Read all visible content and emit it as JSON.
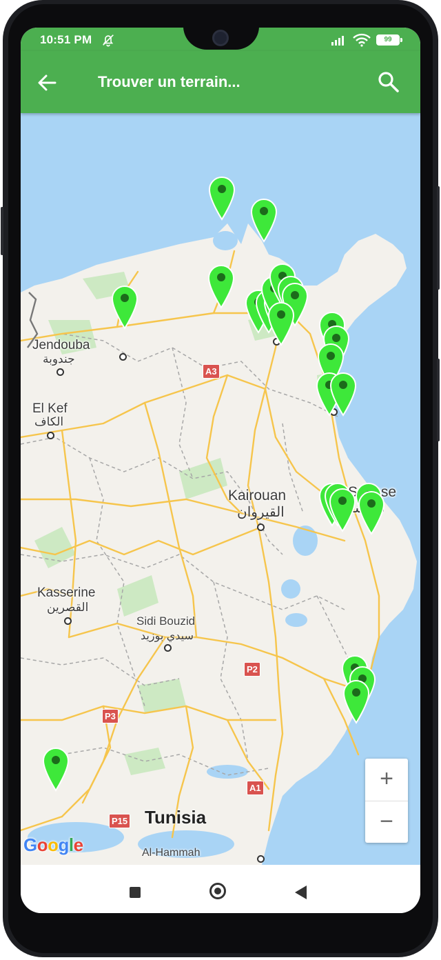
{
  "status_bar": {
    "time": "10:51 PM",
    "battery": "99"
  },
  "app_bar": {
    "title": "Trouver un terrain..."
  },
  "map": {
    "labels": {
      "jendouba": "Jendouba",
      "jendouba_ar": "جندوبة",
      "el_kef": "El Kef",
      "el_kef_ar": "الكاف",
      "kairouan": "Kairouan",
      "kairouan_ar": "القيروان",
      "sousse": "Sousse",
      "sousse_ar": "سوسة",
      "kasserine": "Kasserine",
      "kasserine_ar": "القصرين",
      "sidi_bouzid": "Sidi Bouzid",
      "sidi_bouzid_ar": "سيدي بوزيد",
      "country": "Tunisia",
      "al_hammah": "Al-Hammah"
    },
    "road_shields": [
      "A3",
      "P2",
      "P3",
      "A1",
      "P15"
    ],
    "pin_color": "#3ee83a",
    "water_color": "#a9d4f5",
    "land_color": "#f3f1ec",
    "google_logo": "Google"
  },
  "zoom": {
    "in": "+",
    "out": "−"
  }
}
